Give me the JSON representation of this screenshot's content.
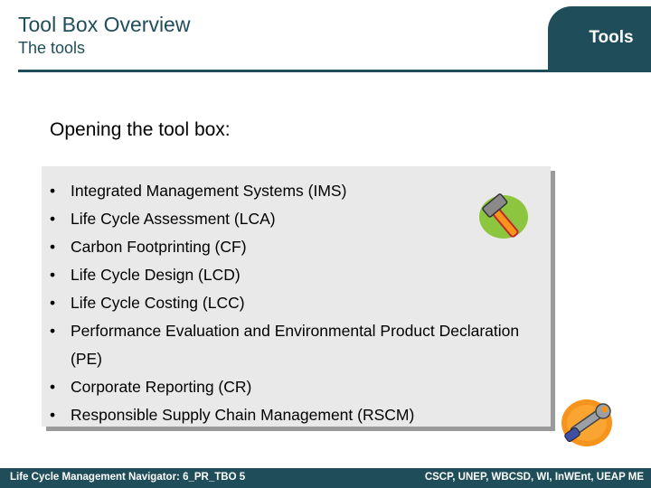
{
  "header": {
    "title": "Tool Box Overview",
    "subtitle": "The tools",
    "tab_label": "Tools"
  },
  "main": {
    "heading": "Opening the tool box:",
    "items": [
      {
        "label": "Integrated Management Systems (IMS)"
      },
      {
        "label": "Life Cycle Assessment (LCA)"
      },
      {
        "label": "Carbon Footprinting (CF)"
      },
      {
        "label": "Life Cycle Design (LCD)"
      },
      {
        "label": "Life Cycle Costing (LCC)"
      },
      {
        "label": "Performance Evaluation and Environmental Product Declaration (PE)"
      },
      {
        "label": "Corporate Reporting (CR)"
      },
      {
        "label": "Responsible Supply Chain Management (RSCM)"
      }
    ],
    "bullet": "•"
  },
  "icons": {
    "hammer": "hammer-icon",
    "wrench": "wrench-icon"
  },
  "footer": {
    "left": "Life Cycle Management Navigator: 6_PR_TBO 5",
    "right": "CSCP, UNEP, WBCSD, WI, InWEnt, UEAP ME"
  },
  "colors": {
    "accent": "#1f4e5a",
    "box_bg": "#e9e9e9",
    "icon_green": "#8cc63f",
    "icon_orange": "#f7941d"
  }
}
